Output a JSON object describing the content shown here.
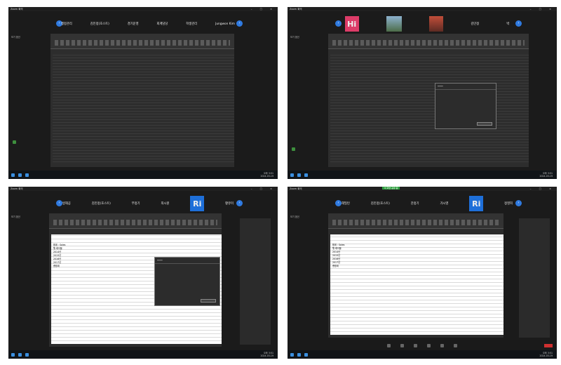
{
  "window": {
    "title": "Zoom 회의"
  },
  "view_label": "보기 옵션",
  "panels": [
    {
      "tiles": [
        "행정관리",
        "김민정(호스트)",
        "경기운영",
        "회계담당",
        "학생관리",
        "Jungwon Kim"
      ]
    },
    {
      "tiles": [
        "Hi",
        "사진",
        "이",
        "김민정",
        "박"
      ]
    },
    {
      "tiles": [
        "방해공",
        "김민정(호스트)",
        "부정기",
        "최시원",
        "Ri",
        "황유미"
      ]
    },
    {
      "tiles": [
        "해밀턴",
        "김민정(호스트)",
        "찬정기",
        "가시영",
        "Ri",
        "정영희"
      ]
    }
  ],
  "pivot": {
    "header": "합계 : Sales",
    "row_label": "행 레이블",
    "rows": [
      "2014년",
      "2015년",
      "2016년",
      "2017년",
      "총합계"
    ]
  },
  "dialog": {
    "ok": "확인"
  },
  "clock": {
    "time": "오후 3:51",
    "date": "2024-03-19"
  },
  "share_banner": "이 화면 공유 중",
  "zoom_bar_end": "종료",
  "icons": [
    "zoom-icon",
    "nav-left-icon",
    "nav-right-icon",
    "pencil-icon"
  ]
}
